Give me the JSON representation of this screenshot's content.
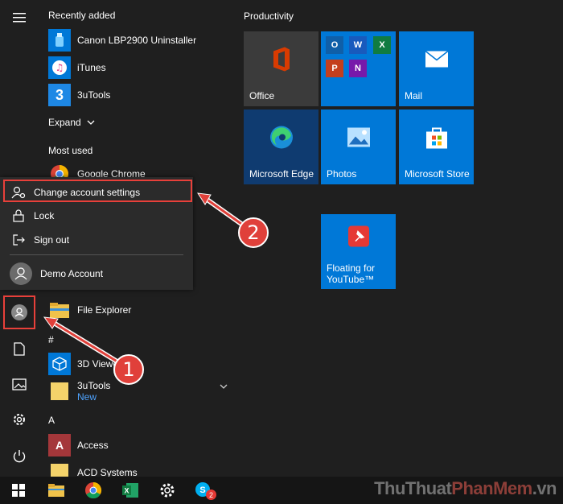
{
  "applist": {
    "recently_added": "Recently added",
    "recent_apps": [
      "Canon LBP2900 Uninstaller",
      "iTunes",
      "3uTools"
    ],
    "expand": "Expand",
    "most_used": "Most used",
    "most_used_app": "Google Chrome",
    "file_explorer": "File Explorer",
    "hash_header": "#",
    "viewer": "3D Viewer",
    "tools": "3uTools",
    "tools_new": "New",
    "a_header": "A",
    "access": "Access",
    "acd": "ACD Systems"
  },
  "flyout": {
    "change_account": "Change account settings",
    "lock": "Lock",
    "sign_out": "Sign out",
    "account_name": "Demo Account"
  },
  "tiles": {
    "group": "Productivity",
    "office": "Office",
    "mail": "Mail",
    "edge": "Microsoft Edge",
    "photos": "Photos",
    "store": "Microsoft Store",
    "floating_1": "Floating for",
    "floating_2": "YouTube™"
  },
  "annotations": {
    "one": "1",
    "two": "2"
  },
  "taskbar": {
    "skype_badge": "2"
  },
  "watermark": {
    "part1": "ThuThuat",
    "part2": "PhanMem",
    "part3": ".vn"
  },
  "colors": {
    "accent": "#0078d7",
    "highlight": "#e8403a"
  }
}
